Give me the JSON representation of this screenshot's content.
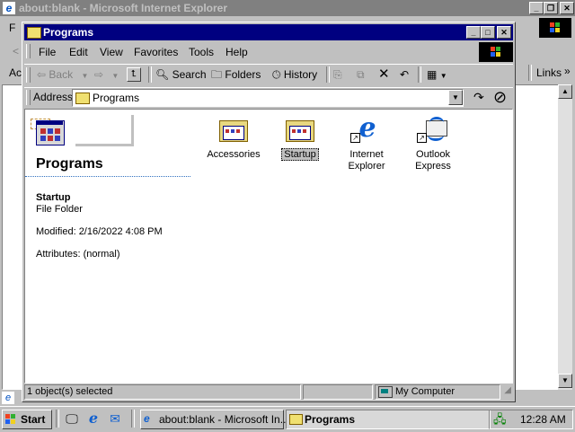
{
  "ie": {
    "title": "about:blank - Microsoft Internet Explorer",
    "menu_partial": [
      "F",
      "<"
    ],
    "address_partial": "Ac",
    "links": "Links"
  },
  "explorer": {
    "title": "Programs",
    "menu": [
      "File",
      "Edit",
      "View",
      "Favorites",
      "Tools",
      "Help"
    ],
    "toolbar": {
      "back": "Back",
      "search": "Search",
      "folders": "Folders",
      "history": "History"
    },
    "address_label": "Address",
    "address_value": "Programs",
    "folder_title": "Programs",
    "selected_name": "Startup",
    "selected_type": "File Folder",
    "modified": "Modified: 2/16/2022 4:08 PM",
    "attributes": "Attributes: (normal)",
    "items": [
      {
        "line1": "Accessories",
        "line2": ""
      },
      {
        "line1": "Startup",
        "line2": ""
      },
      {
        "line1": "Internet",
        "line2": "Explorer"
      },
      {
        "line1": "Outlook",
        "line2": "Express"
      }
    ],
    "status_left": "1 object(s) selected",
    "status_right": "My Computer"
  },
  "taskbar": {
    "start": "Start",
    "tasks": [
      "about:blank - Microsoft In...",
      "Programs"
    ],
    "clock": "12:28 AM"
  }
}
